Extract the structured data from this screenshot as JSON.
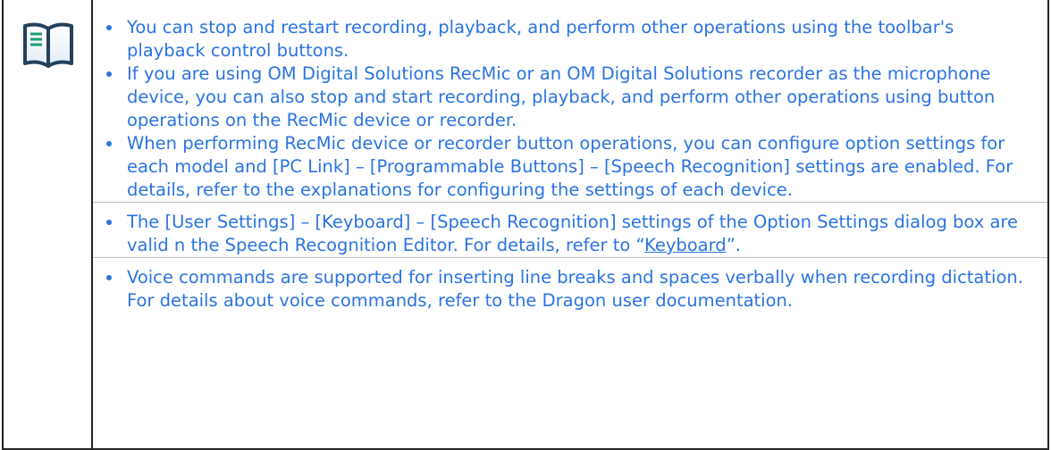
{
  "note": {
    "icon": "book-icon",
    "accent_color": "#2b74e0",
    "groups": [
      {
        "items": [
          {
            "text": "You can stop and restart recording, playback, and perform other operations using the toolbar's playback control buttons."
          },
          {
            "text": "If you are using OM Digital Solutions RecMic or an OM Digital Solutions recorder as the microphone device, you can also stop and start recording, playback, and perform other operations using button operations on the RecMic device or recorder."
          },
          {
            "text": " When performing RecMic device or recorder button operations, you can configure option settings for each model and [PC Link] – [Programmable Buttons] – [Speech Recognition] settings are enabled. For details, refer to the explanations for configuring the settings of each device."
          }
        ]
      },
      {
        "items": [
          {
            "text_before": "The [User Settings] – [Keyboard] – [Speech Recognition] settings of the Option Settings dialog box are valid n the Speech Recognition Editor. For details, refer to “",
            "link_text": "Keyboard",
            "text_after": "”."
          }
        ]
      },
      {
        "items": [
          {
            "text": "Voice commands are supported for inserting line breaks and spaces verbally when recording dictation. For details about voice commands, refer to the Dragon user documentation."
          }
        ]
      }
    ]
  }
}
